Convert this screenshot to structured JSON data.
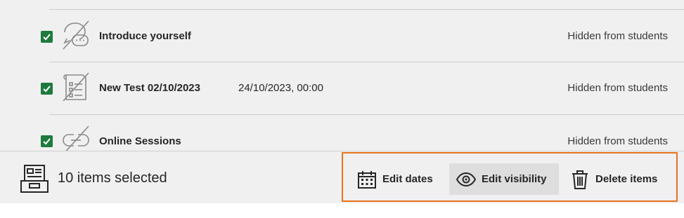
{
  "items": [
    {
      "title": "Introduce yourself",
      "due": "",
      "status": "Hidden from students",
      "icon": "discussion-hidden-icon"
    },
    {
      "title": "New Test 02/10/2023",
      "due": "24/10/2023, 00:00",
      "status": "Hidden from students",
      "icon": "test-hidden-icon"
    },
    {
      "title": "Online Sessions",
      "due": "",
      "status": "Hidden from students",
      "icon": "link-hidden-icon"
    }
  ],
  "footer": {
    "selected_text": "10 items selected",
    "actions": {
      "edit_dates": "Edit dates",
      "edit_visibility": "Edit visibility",
      "delete_items": "Delete items"
    }
  },
  "colors": {
    "checkbox": "#1e7a3e",
    "highlight": "#e8731c",
    "panel": "#f0f0f0"
  }
}
